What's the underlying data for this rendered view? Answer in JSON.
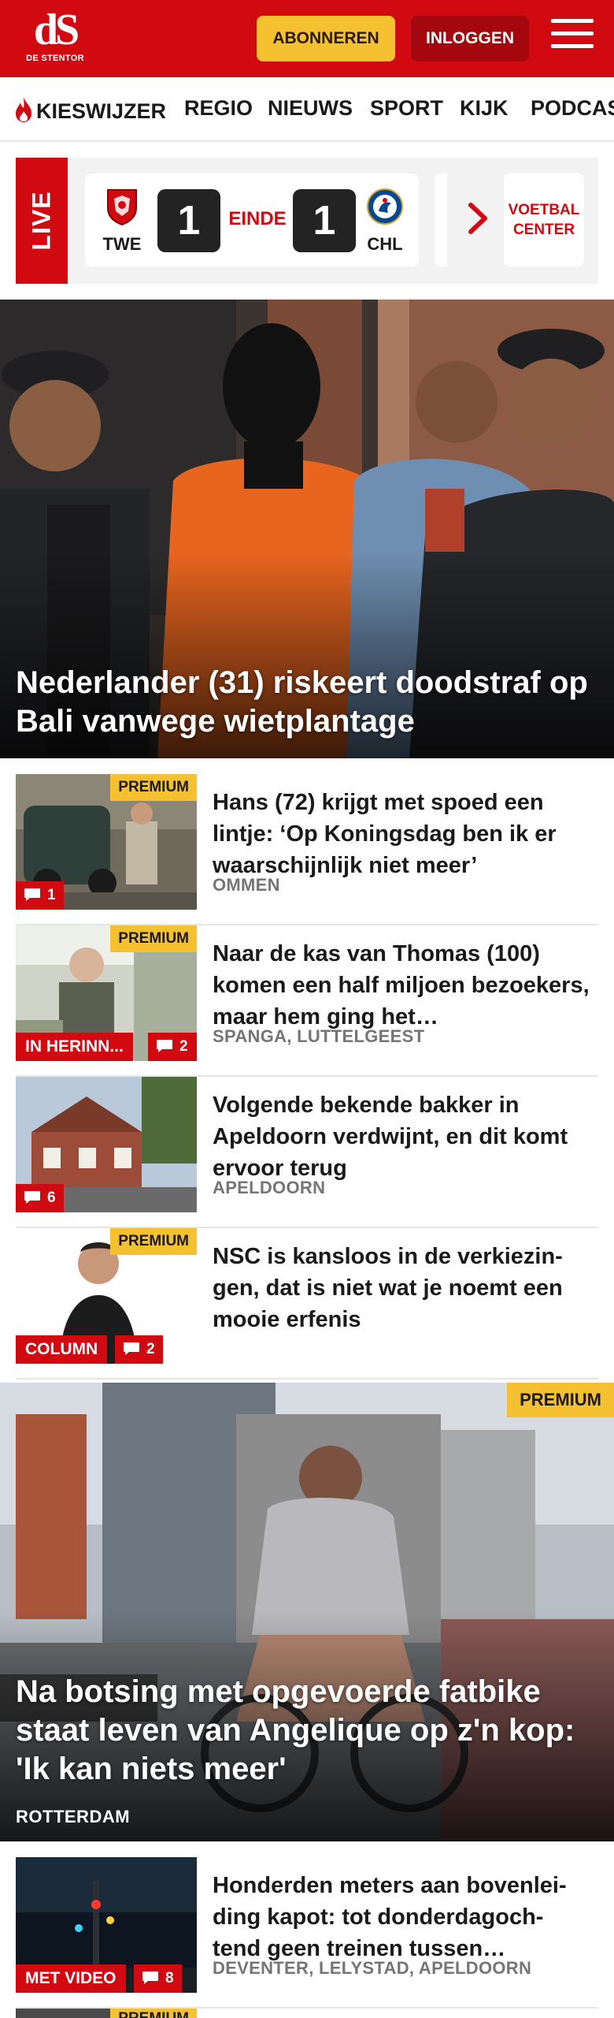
{
  "header": {
    "logo_mark": "dS",
    "logo_sub": "DE STENTOR",
    "subscribe_label": "ABONNEREN",
    "login_label": "INLOGGEN"
  },
  "nav": {
    "items": [
      "KIESWIJZER",
      "REGIO",
      "NIEUWS",
      "SPORT",
      "KIJK",
      "PODCASTS"
    ]
  },
  "live": {
    "label": "LIVE",
    "home_team": "TWE",
    "home_score": "1",
    "status": "EINDE",
    "away_score": "1",
    "away_team": "CHL",
    "center_label": "VOETBAL CENTER"
  },
  "hero": {
    "title": "Nederlander (31) riskeert doodstraf op Bali vanwege wietplantage"
  },
  "articles": [
    {
      "title": "Hans (72) krijgt met spoed een lintje: ‘Op Koningsdag ben ik er waarschijnlijk niet meer’",
      "place": "OMMEN",
      "premium": "PREMIUM",
      "comments": "1"
    },
    {
      "title": "Naar de kas van Thomas (100) komen een half miljoen bezoekers, maar hem ging het…",
      "place": "SPANGA, LUTTELGEEST",
      "premium": "PREMIUM",
      "label": "IN HERINN...",
      "comments": "2"
    },
    {
      "title": "Volgende bekende bakker in Apeldoorn verdwijnt, en dit komt ervoor terug",
      "place": "APELDOORN",
      "comments": "6"
    },
    {
      "title": "NSC is kansloos in de verkiezin-gen, dat is niet wat je noemt een mooie erfenis",
      "premium": "PREMIUM",
      "label": "COLUMN",
      "comments": "2"
    }
  ],
  "feature": {
    "premium": "PREMIUM",
    "title": "Na botsing met opgevoerde fatbike staat leven van Angelique op z'n kop: 'Ik kan niets meer'",
    "place": "ROTTERDAM"
  },
  "articles2": [
    {
      "title": "Honderden meters aan bovenlei-ding kapot: tot donderdagoch-tend geen treinen tussen…",
      "place": "DEVENTER, LELYSTAD, APELDOORN",
      "label": "MET VIDEO",
      "comments": "8"
    },
    {
      "premium": "PREMIUM"
    }
  ],
  "colors": {
    "brand_red": "#d10a11",
    "login_red": "#a4080e",
    "premium_yellow": "#f6c131",
    "meta_gray": "#757575"
  }
}
